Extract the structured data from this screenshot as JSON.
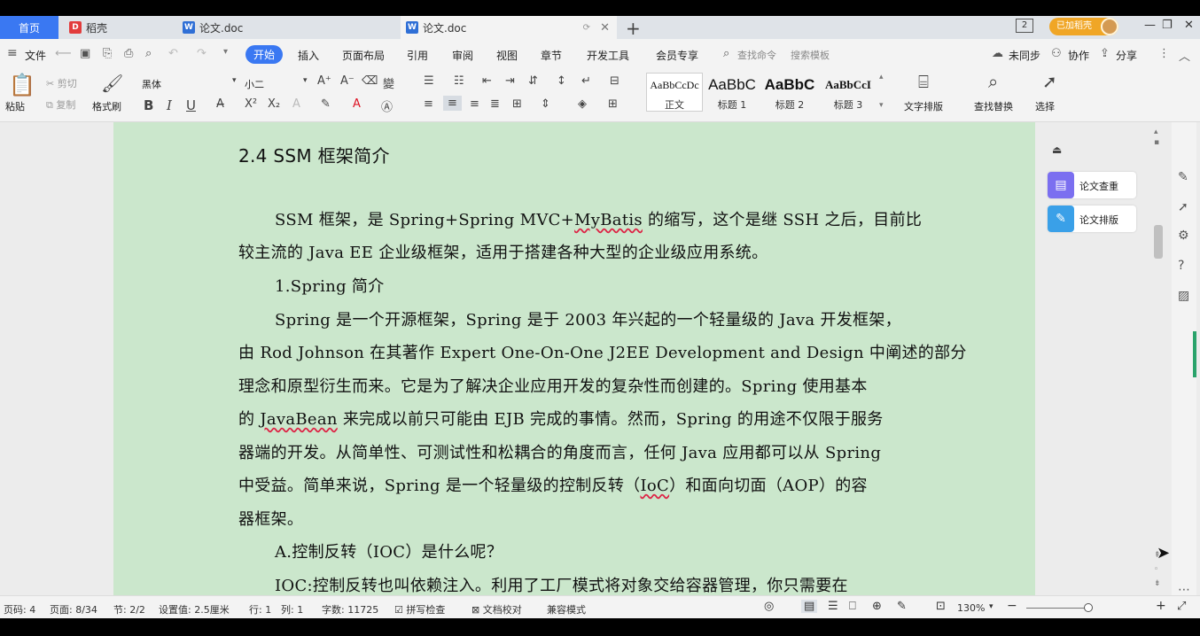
{
  "tabs": {
    "home": "首页",
    "dao": "稻壳",
    "doc1": "论文.doc",
    "doc2": "论文.doc",
    "vip": "已加稻壳"
  },
  "menu": {
    "file": "文件",
    "items": [
      "开始",
      "插入",
      "页面布局",
      "引用",
      "审阅",
      "视图",
      "章节",
      "开发工具",
      "会员专享"
    ],
    "search_cmd": "查找命令",
    "search_template": "搜索模板",
    "sync": "未同步",
    "collab": "协作",
    "share": "分享"
  },
  "ribbon": {
    "paste": "粘贴",
    "cut": "剪切",
    "copy": "复制",
    "format_painter": "格式刷",
    "font_name": "黑体",
    "font_size": "小二",
    "styles": [
      {
        "sample": "AaBbCcDc",
        "name": "正文"
      },
      {
        "sample": "AaBbC",
        "name": "标题 1"
      },
      {
        "sample": "AaBbC",
        "name": "标题 2"
      },
      {
        "sample": "AaBbCcI",
        "name": "标题 3"
      }
    ],
    "text_layout": "文字排版",
    "find_replace": "查找替换",
    "select": "选择"
  },
  "document": {
    "heading": "2.4 SSM 框架简介",
    "lines": [
      "SSM 框架，是 Spring+Spring MVC+",
      "比较主流的 Java EE 企业级框架，适用于搭建各种大型的企业级应用系统。",
      "1.Spring 简介",
      "Spring 是一个开源框架，Spring 是于 2003 年兴起的一个轻量级的 Java 开发框架，",
      "由 Rod Johnson 在其著作 Expert One-On-One J2EE Development and Design 中阐述的部分",
      "理念和原型衍生而来。它是为了解决企业应用开发的复杂性而创建的。Spring 使用基本",
      "来完成以前只可能由 EJB 完成的事情。然而，Spring 的用途不仅限于服务",
      "器端的开发。从简单性、可测试性和松耦合的角度而言，任何 Java 应用都可以从 Spring",
      "中受益。简单来说，Spring 是一个轻量级的控制反转（",
      "）和面向切面（AOP）的容",
      "器框架。",
      "A.控制反转（IOC）是什么呢？",
      "IOC:控制反转也叫依赖注入。利用了工厂模式将对象交给容器管理，你只需要在"
    ],
    "line0_tail": "MyBatis",
    "line0_end": " 的缩写，这个是继 SSH 之后，目前比",
    "line1_start": "较主流的 Java EE 企业级框架，适用于搭建各种大型的企业级应用系统。",
    "line6_start": "的 ",
    "javabean": "JavaBean",
    "ioc": "IoC"
  },
  "side_panel": {
    "check": "论文查重",
    "layout": "论文排版"
  },
  "status": {
    "page_code": "页码: 4",
    "page": "页面: 8/34",
    "section": "节: 2/2",
    "setting": "设置值: 2.5厘米",
    "row": "行: 1",
    "col": "列: 1",
    "chars": "字数: 11725",
    "spell": "拼写检查",
    "proof": "文档校对",
    "compat": "兼容模式",
    "zoom": "130%"
  }
}
